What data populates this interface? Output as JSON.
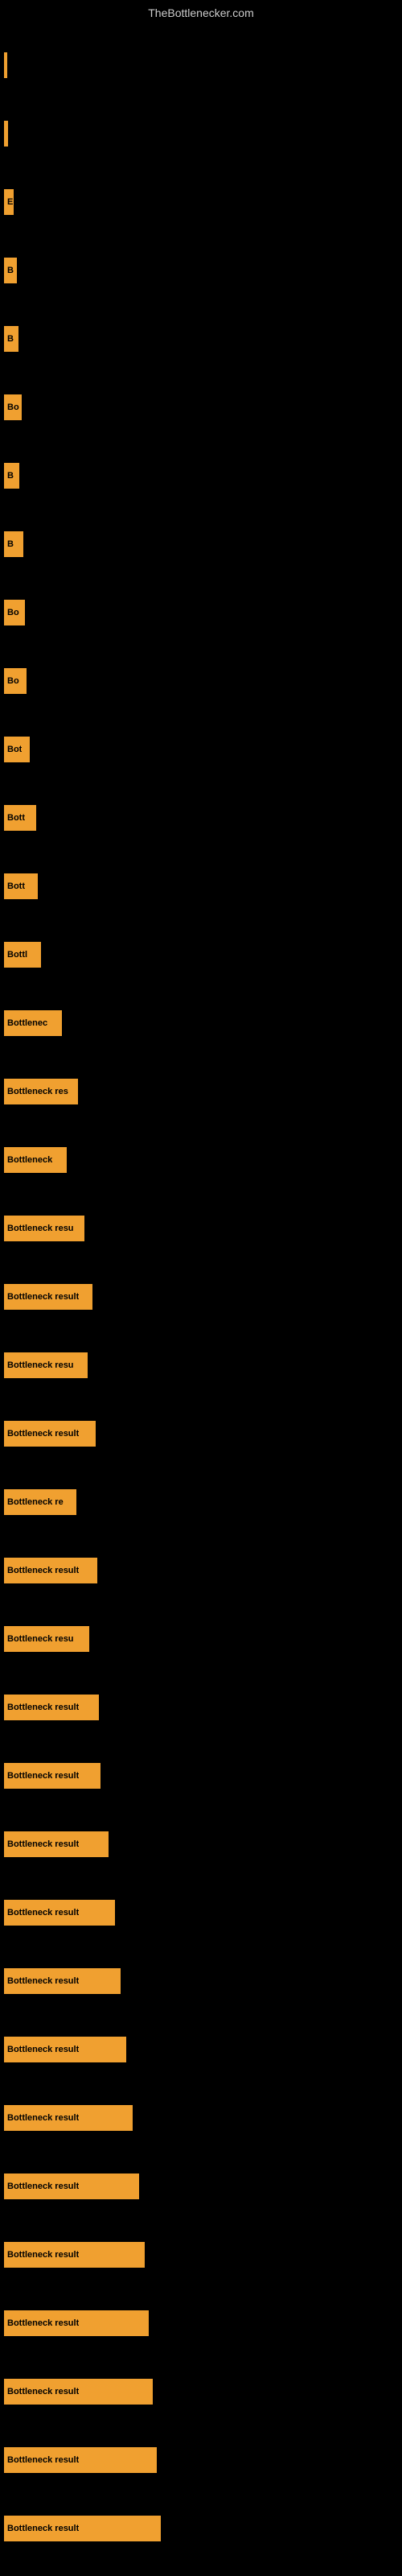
{
  "header": {
    "title": "TheBottlenecker.com"
  },
  "bars": [
    {
      "label": "",
      "width": 4
    },
    {
      "label": "",
      "width": 5
    },
    {
      "label": "E",
      "width": 12
    },
    {
      "label": "B",
      "width": 16
    },
    {
      "label": "B",
      "width": 18
    },
    {
      "label": "Bo",
      "width": 22
    },
    {
      "label": "B",
      "width": 19
    },
    {
      "label": "B",
      "width": 24
    },
    {
      "label": "Bo",
      "width": 26
    },
    {
      "label": "Bo",
      "width": 28
    },
    {
      "label": "Bot",
      "width": 32
    },
    {
      "label": "Bott",
      "width": 40
    },
    {
      "label": "Bott",
      "width": 42
    },
    {
      "label": "Bottl",
      "width": 46
    },
    {
      "label": "Bottlenec",
      "width": 72
    },
    {
      "label": "Bottleneck res",
      "width": 92
    },
    {
      "label": "Bottleneck",
      "width": 78
    },
    {
      "label": "Bottleneck resu",
      "width": 100
    },
    {
      "label": "Bottleneck result",
      "width": 110
    },
    {
      "label": "Bottleneck resu",
      "width": 104
    },
    {
      "label": "Bottleneck result",
      "width": 114
    },
    {
      "label": "Bottleneck re",
      "width": 90
    },
    {
      "label": "Bottleneck result",
      "width": 116
    },
    {
      "label": "Bottleneck resu",
      "width": 106
    },
    {
      "label": "Bottleneck result",
      "width": 118
    },
    {
      "label": "Bottleneck result",
      "width": 120
    },
    {
      "label": "Bottleneck result",
      "width": 130
    },
    {
      "label": "Bottleneck result",
      "width": 138
    },
    {
      "label": "Bottleneck result",
      "width": 145
    },
    {
      "label": "Bottleneck result",
      "width": 152
    },
    {
      "label": "Bottleneck result",
      "width": 160
    },
    {
      "label": "Bottleneck result",
      "width": 168
    },
    {
      "label": "Bottleneck result",
      "width": 175
    },
    {
      "label": "Bottleneck result",
      "width": 180
    },
    {
      "label": "Bottleneck result",
      "width": 185
    },
    {
      "label": "Bottleneck result",
      "width": 190
    },
    {
      "label": "Bottleneck result",
      "width": 195
    }
  ]
}
